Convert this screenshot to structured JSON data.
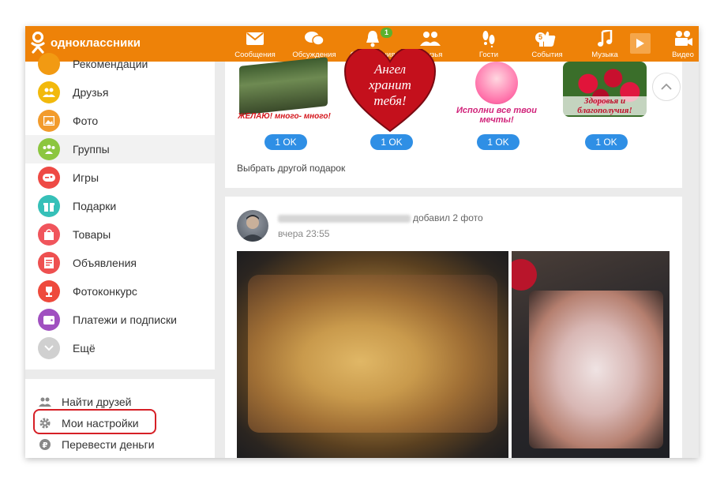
{
  "app": {
    "name": "одноклассники"
  },
  "nav": [
    {
      "label": "Сообщения",
      "icon": "envelope-icon"
    },
    {
      "label": "Обсуждения",
      "icon": "chat-bubbles-icon"
    },
    {
      "label": "Оповещения",
      "icon": "bell-icon",
      "badge": "1"
    },
    {
      "label": "Друзья",
      "icon": "friends-icon"
    },
    {
      "label": "Гости",
      "icon": "footprints-icon"
    },
    {
      "label": "События",
      "icon": "thumbs-up-icon",
      "badge": "5"
    },
    {
      "label": "Музыка",
      "icon": "music-note-icon"
    },
    {
      "label": "Видео",
      "icon": "video-camera-icon"
    }
  ],
  "sidebar": {
    "items": [
      {
        "label": "Рекомендации",
        "color": "#f29a12"
      },
      {
        "label": "Друзья",
        "color": "#f2b90c"
      },
      {
        "label": "Фото",
        "color": "#f29b2c"
      },
      {
        "label": "Группы",
        "color": "#8cc63f"
      },
      {
        "label": "Игры",
        "color": "#ee4a45"
      },
      {
        "label": "Подарки",
        "color": "#36c0b8"
      },
      {
        "label": "Товары",
        "color": "#f0555c"
      },
      {
        "label": "Объявления",
        "color": "#ee5050"
      },
      {
        "label": "Фотоконкурс",
        "color": "#ee4a3c"
      },
      {
        "label": "Платежи и подписки",
        "color": "#a050c0"
      },
      {
        "label": "Ещё",
        "color": "#d0d0d0"
      }
    ],
    "links": [
      {
        "label": "Найти друзей",
        "icon": "people-icon"
      },
      {
        "label": "Мои настройки",
        "icon": "gear-icon"
      },
      {
        "label": "Перевести деньги",
        "icon": "ruble-icon"
      }
    ]
  },
  "gifts": {
    "items": [
      {
        "caption": "ЖЕЛАЮ! много- много!",
        "button": "1 OK"
      },
      {
        "caption": "Ангел хранит тебя!",
        "button": "1 OK"
      },
      {
        "caption": "Исполни все твои мечты!",
        "button": "1 OK"
      },
      {
        "caption": "Здоровья и благополучия!",
        "button": "1 OK"
      }
    ],
    "choose_other": "Выбрать другой подарок"
  },
  "post": {
    "action": "добавил 2 фото",
    "time": "вчера 23:55"
  }
}
